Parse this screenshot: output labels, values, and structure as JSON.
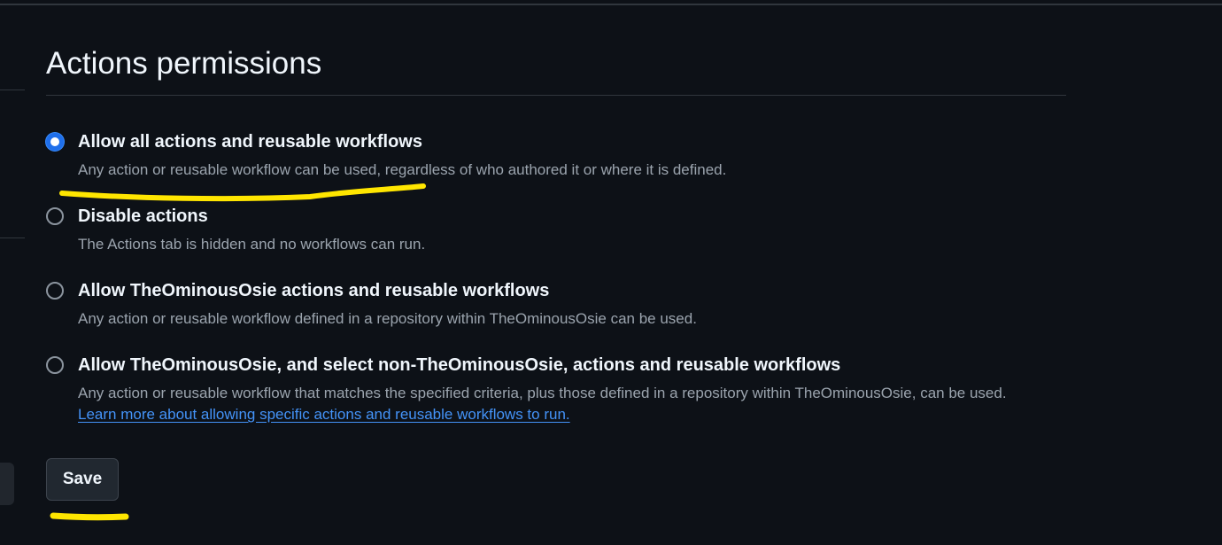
{
  "section": {
    "title": "Actions permissions"
  },
  "options": [
    {
      "label": "Allow all actions and reusable workflows",
      "description": "Any action or reusable workflow can be used, regardless of who authored it or where it is defined.",
      "checked": true
    },
    {
      "label": "Disable actions",
      "description": "The Actions tab is hidden and no workflows can run.",
      "checked": false
    },
    {
      "label": "Allow TheOminousOsie actions and reusable workflows",
      "description": "Any action or reusable workflow defined in a repository within TheOminousOsie can be used.",
      "checked": false
    },
    {
      "label": "Allow TheOminousOsie, and select non-TheOminousOsie, actions and reusable workflows",
      "description": "Any action or reusable workflow that matches the specified criteria, plus those defined in a repository within TheOminousOsie, can be used.",
      "link": "Learn more about allowing specific actions and reusable workflows to run.",
      "checked": false
    }
  ],
  "actions": {
    "save_label": "Save"
  },
  "colors": {
    "background": "#0d1117",
    "accent": "#1f6feb",
    "link": "#4493f8",
    "annotation_highlight": "#ffe600"
  }
}
